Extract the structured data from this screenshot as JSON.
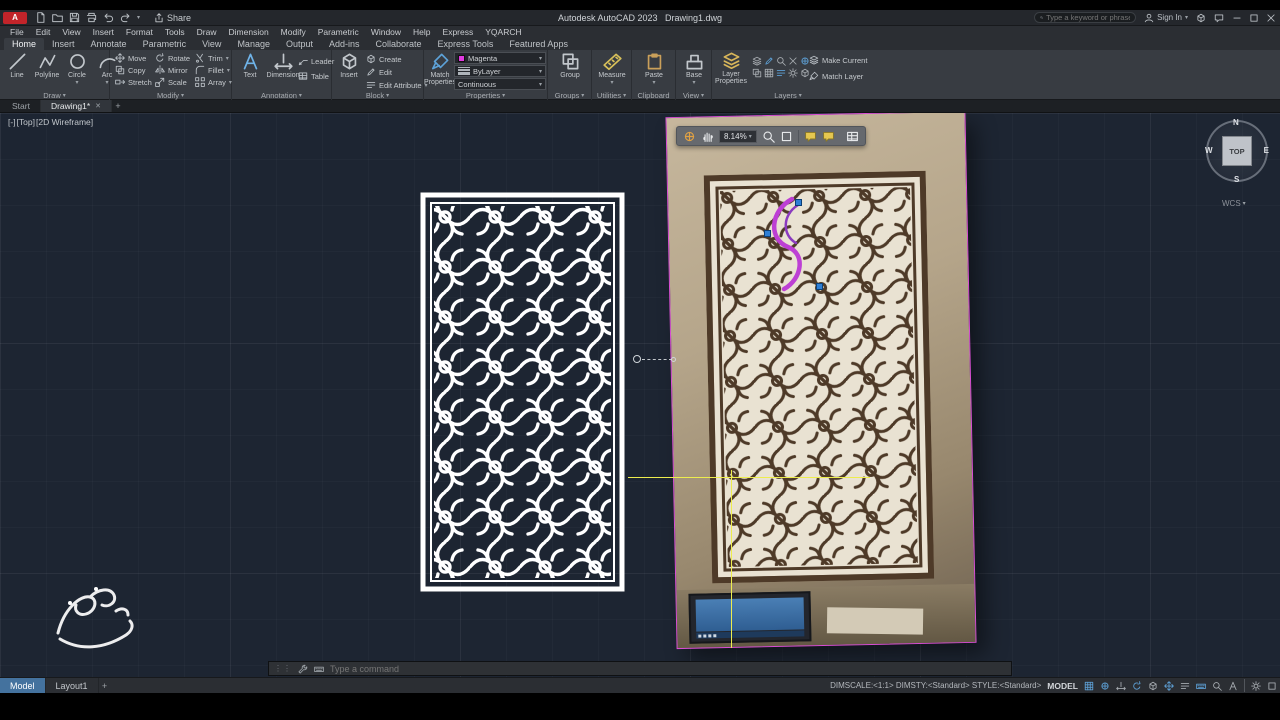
{
  "window": {
    "logo": "A",
    "title": "Autodesk AutoCAD 2023",
    "file": "Drawing1.dwg",
    "share": "Share",
    "search_placeholder": "Type a keyword or phrase",
    "sign_in": "Sign In"
  },
  "menu": [
    "File",
    "Edit",
    "View",
    "Insert",
    "Format",
    "Tools",
    "Draw",
    "Dimension",
    "Modify",
    "Parametric",
    "Window",
    "Help",
    "Express",
    "YQARCH"
  ],
  "ribbon_tabs": [
    "Home",
    "Insert",
    "Annotate",
    "Parametric",
    "View",
    "Manage",
    "Output",
    "Add-ins",
    "Collaborate",
    "Express Tools",
    "Featured Apps"
  ],
  "panels": {
    "draw": {
      "label": "Draw",
      "line": "Line",
      "polyline": "Polyline",
      "circle": "Circle",
      "arc": "Arc"
    },
    "modify": {
      "label": "Modify",
      "tools": [
        "Move",
        "Rotate",
        "Trim",
        "Copy",
        "Mirror",
        "Fillet",
        "Stretch",
        "Scale",
        "Array"
      ]
    },
    "annotation": {
      "label": "Annotation",
      "text": "Text",
      "dimension": "Dimension",
      "leader": "Leader",
      "table": "Table"
    },
    "block": {
      "label": "Block",
      "insert": "Insert",
      "create": "Create",
      "edit": "Edit",
      "edit_attributes": "Edit Attribute"
    },
    "properties": {
      "label": "Properties",
      "match": "Match Properties",
      "color": "Magenta",
      "lineweight": "ByLayer",
      "linetype": "Continuous"
    },
    "groups": {
      "label": "Groups",
      "group": "Group"
    },
    "utilities": {
      "label": "Utilities",
      "measure": "Measure"
    },
    "clipboard": {
      "label": "Clipboard",
      "paste": "Paste"
    },
    "view": {
      "label": "View",
      "base": "Base"
    },
    "layers": {
      "label": "Layers",
      "layer_properties": "Layer Properties",
      "make_current": "Make Current",
      "match_layer": "Match Layer"
    }
  },
  "file_tabs": {
    "start": "Start",
    "drawing": "Drawing1*"
  },
  "viewport": {
    "controls": [
      "[-]",
      "[Top]",
      "[2D Wireframe]"
    ]
  },
  "viewcube": {
    "north": "N",
    "south": "S",
    "east": "E",
    "west": "W",
    "top": "TOP",
    "wcs": "WCS"
  },
  "overlay_toolbar": {
    "zoom": "8.14%"
  },
  "command": {
    "placeholder": "Type a command"
  },
  "layout_tabs": {
    "model": "Model",
    "layout1": "Layout1"
  },
  "status": {
    "dim_text": "DIMSCALE:<1:1> DIMSTY:<Standard> STYLE:<Standard>",
    "model": "MODEL"
  },
  "colors": {
    "accent_magenta": "#d94fd4",
    "construction_yellow": "#eded4e",
    "grip_blue": "#2e7fd6",
    "pattern_white": "#ffffff",
    "pattern_brown": "#4e3a28"
  }
}
